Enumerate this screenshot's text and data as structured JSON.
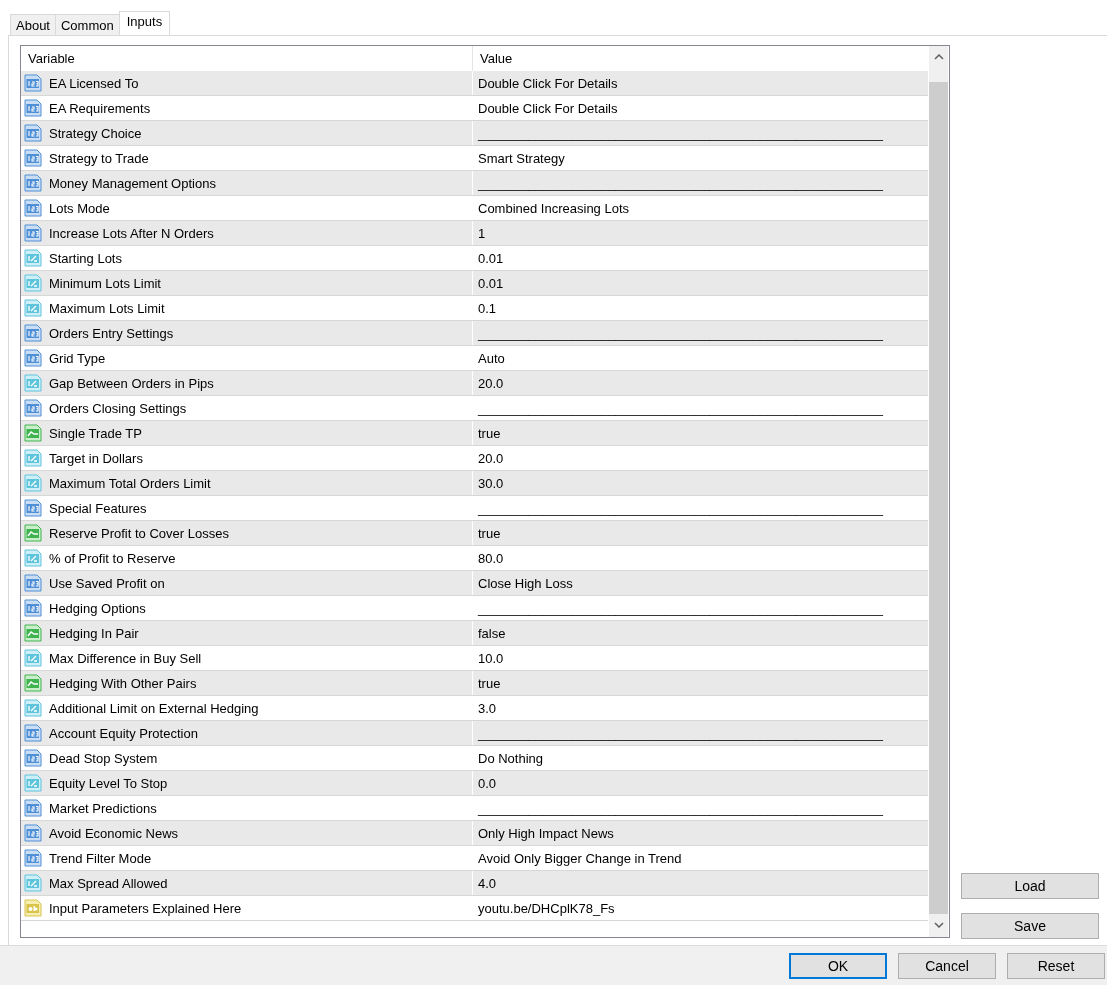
{
  "tabs": [
    {
      "label": "About",
      "selected": false
    },
    {
      "label": "Common",
      "selected": false
    },
    {
      "label": "Inputs",
      "selected": true
    }
  ],
  "table": {
    "columns": [
      "Variable",
      "Value"
    ],
    "rows": [
      {
        "kind": "int",
        "variable": "EA Licensed To",
        "value": "Double Click For Details"
      },
      {
        "kind": "int",
        "variable": "EA Requirements",
        "value": "Double Click For Details"
      },
      {
        "kind": "int",
        "variable": "Strategy Choice",
        "value": "________________________________________________________"
      },
      {
        "kind": "int",
        "variable": "Strategy to Trade",
        "value": "Smart Strategy"
      },
      {
        "kind": "int",
        "variable": "Money Management Options",
        "value": "________________________________________________________"
      },
      {
        "kind": "int",
        "variable": "Lots Mode",
        "value": "Combined Increasing Lots"
      },
      {
        "kind": "int",
        "variable": "Increase Lots After N Orders",
        "value": "1"
      },
      {
        "kind": "double",
        "variable": "Starting Lots",
        "value": "0.01"
      },
      {
        "kind": "double",
        "variable": "Minimum Lots Limit",
        "value": "0.01"
      },
      {
        "kind": "double",
        "variable": "Maximum Lots Limit",
        "value": "0.1"
      },
      {
        "kind": "int",
        "variable": "Orders Entry Settings",
        "value": "________________________________________________________"
      },
      {
        "kind": "int",
        "variable": "Grid Type",
        "value": "Auto"
      },
      {
        "kind": "double",
        "variable": "Gap Between Orders in Pips",
        "value": "20.0"
      },
      {
        "kind": "int",
        "variable": "Orders Closing Settings",
        "value": "________________________________________________________"
      },
      {
        "kind": "bool",
        "variable": "Single Trade TP",
        "value": "true"
      },
      {
        "kind": "double",
        "variable": "Target in Dollars",
        "value": "20.0"
      },
      {
        "kind": "double",
        "variable": "Maximum Total Orders Limit",
        "value": "30.0"
      },
      {
        "kind": "int",
        "variable": "Special Features",
        "value": "________________________________________________________"
      },
      {
        "kind": "bool",
        "variable": "Reserve Profit to Cover Losses",
        "value": "true"
      },
      {
        "kind": "double",
        "variable": "% of Profit to Reserve",
        "value": "80.0"
      },
      {
        "kind": "int",
        "variable": "Use Saved Profit on",
        "value": "Close High Loss"
      },
      {
        "kind": "int",
        "variable": "Hedging Options",
        "value": "________________________________________________________"
      },
      {
        "kind": "bool",
        "variable": "Hedging In Pair",
        "value": "false"
      },
      {
        "kind": "double",
        "variable": "Max Difference in Buy Sell",
        "value": "10.0"
      },
      {
        "kind": "bool",
        "variable": "Hedging With Other Pairs",
        "value": "true"
      },
      {
        "kind": "double",
        "variable": "Additional Limit on External Hedging",
        "value": "3.0"
      },
      {
        "kind": "int",
        "variable": "Account Equity Protection",
        "value": "________________________________________________________"
      },
      {
        "kind": "int",
        "variable": "Dead Stop System",
        "value": "Do Nothing"
      },
      {
        "kind": "double",
        "variable": "Equity Level To Stop",
        "value": "0.0"
      },
      {
        "kind": "int",
        "variable": "Market Predictions",
        "value": "________________________________________________________"
      },
      {
        "kind": "int",
        "variable": "Avoid Economic News",
        "value": "Only High Impact News"
      },
      {
        "kind": "int",
        "variable": "Trend Filter Mode",
        "value": "Avoid Only Bigger Change in Trend"
      },
      {
        "kind": "double",
        "variable": "Max Spread Allowed",
        "value": "4.0"
      },
      {
        "kind": "string",
        "variable": "Input Parameters Explained Here",
        "value": "youtu.be/DHCplK78_Fs"
      }
    ]
  },
  "side_buttons": [
    "Load",
    "Save"
  ],
  "footer_buttons": [
    {
      "label": "OK",
      "default": true
    },
    {
      "label": "Cancel",
      "default": false
    },
    {
      "label": "Reset",
      "default": false
    }
  ]
}
